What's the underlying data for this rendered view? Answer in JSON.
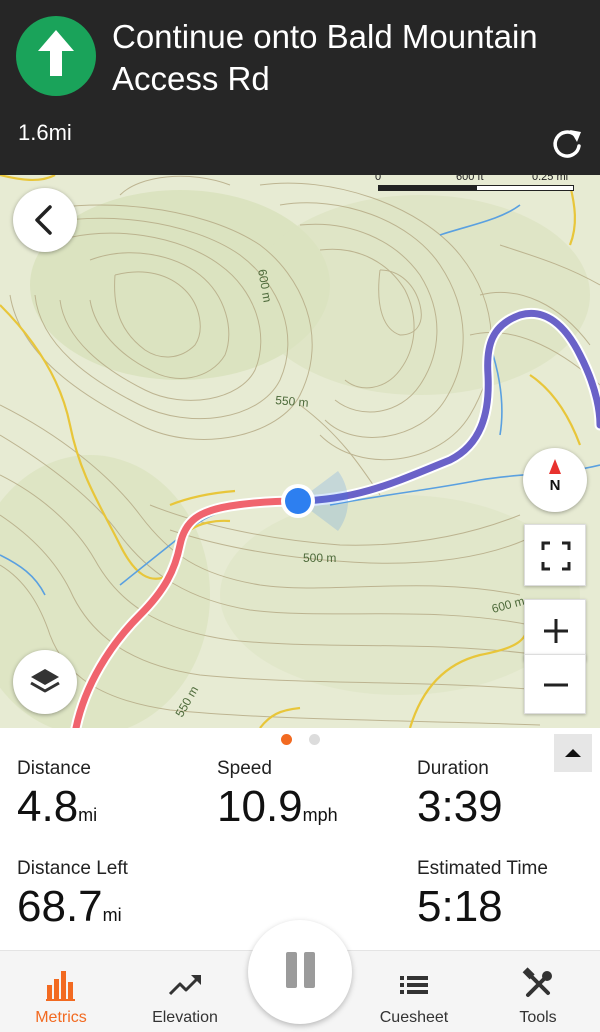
{
  "navigation": {
    "instruction": "Continue onto Bald Mountain Access Rd",
    "distance": "1.6mi",
    "maneuver_icon": "straight-arrow-icon",
    "maneuver_color": "#1aa35a"
  },
  "map": {
    "scale": {
      "start": "0",
      "middle": "600 ft",
      "end": "0.25 mi"
    },
    "contour_labels": [
      "600 m",
      "550 m",
      "500 m",
      "600 m",
      "550 m"
    ],
    "compass_label": "N",
    "route_traveled_color": "#f0646e",
    "route_ahead_color": "#6a62c8",
    "location_color": "#2d7ff0"
  },
  "metrics": {
    "distance": {
      "label": "Distance",
      "value": "4.8",
      "unit": "mi"
    },
    "speed": {
      "label": "Speed",
      "value": "10.9",
      "unit": "mph"
    },
    "duration": {
      "label": "Duration",
      "value": "3:39"
    },
    "distance_left": {
      "label": "Distance Left",
      "value": "68.7",
      "unit": "mi"
    },
    "estimated_time": {
      "label": "Estimated Time",
      "value": "5:18"
    }
  },
  "tabs": [
    {
      "label": "Metrics",
      "icon": "bar-chart-icon",
      "active": true
    },
    {
      "label": "Elevation",
      "icon": "trend-up-icon",
      "active": false
    },
    {
      "label": "Cuesheet",
      "icon": "list-icon",
      "active": false
    },
    {
      "label": "Tools",
      "icon": "tools-icon",
      "active": false
    }
  ],
  "accent_color": "#f26a21"
}
